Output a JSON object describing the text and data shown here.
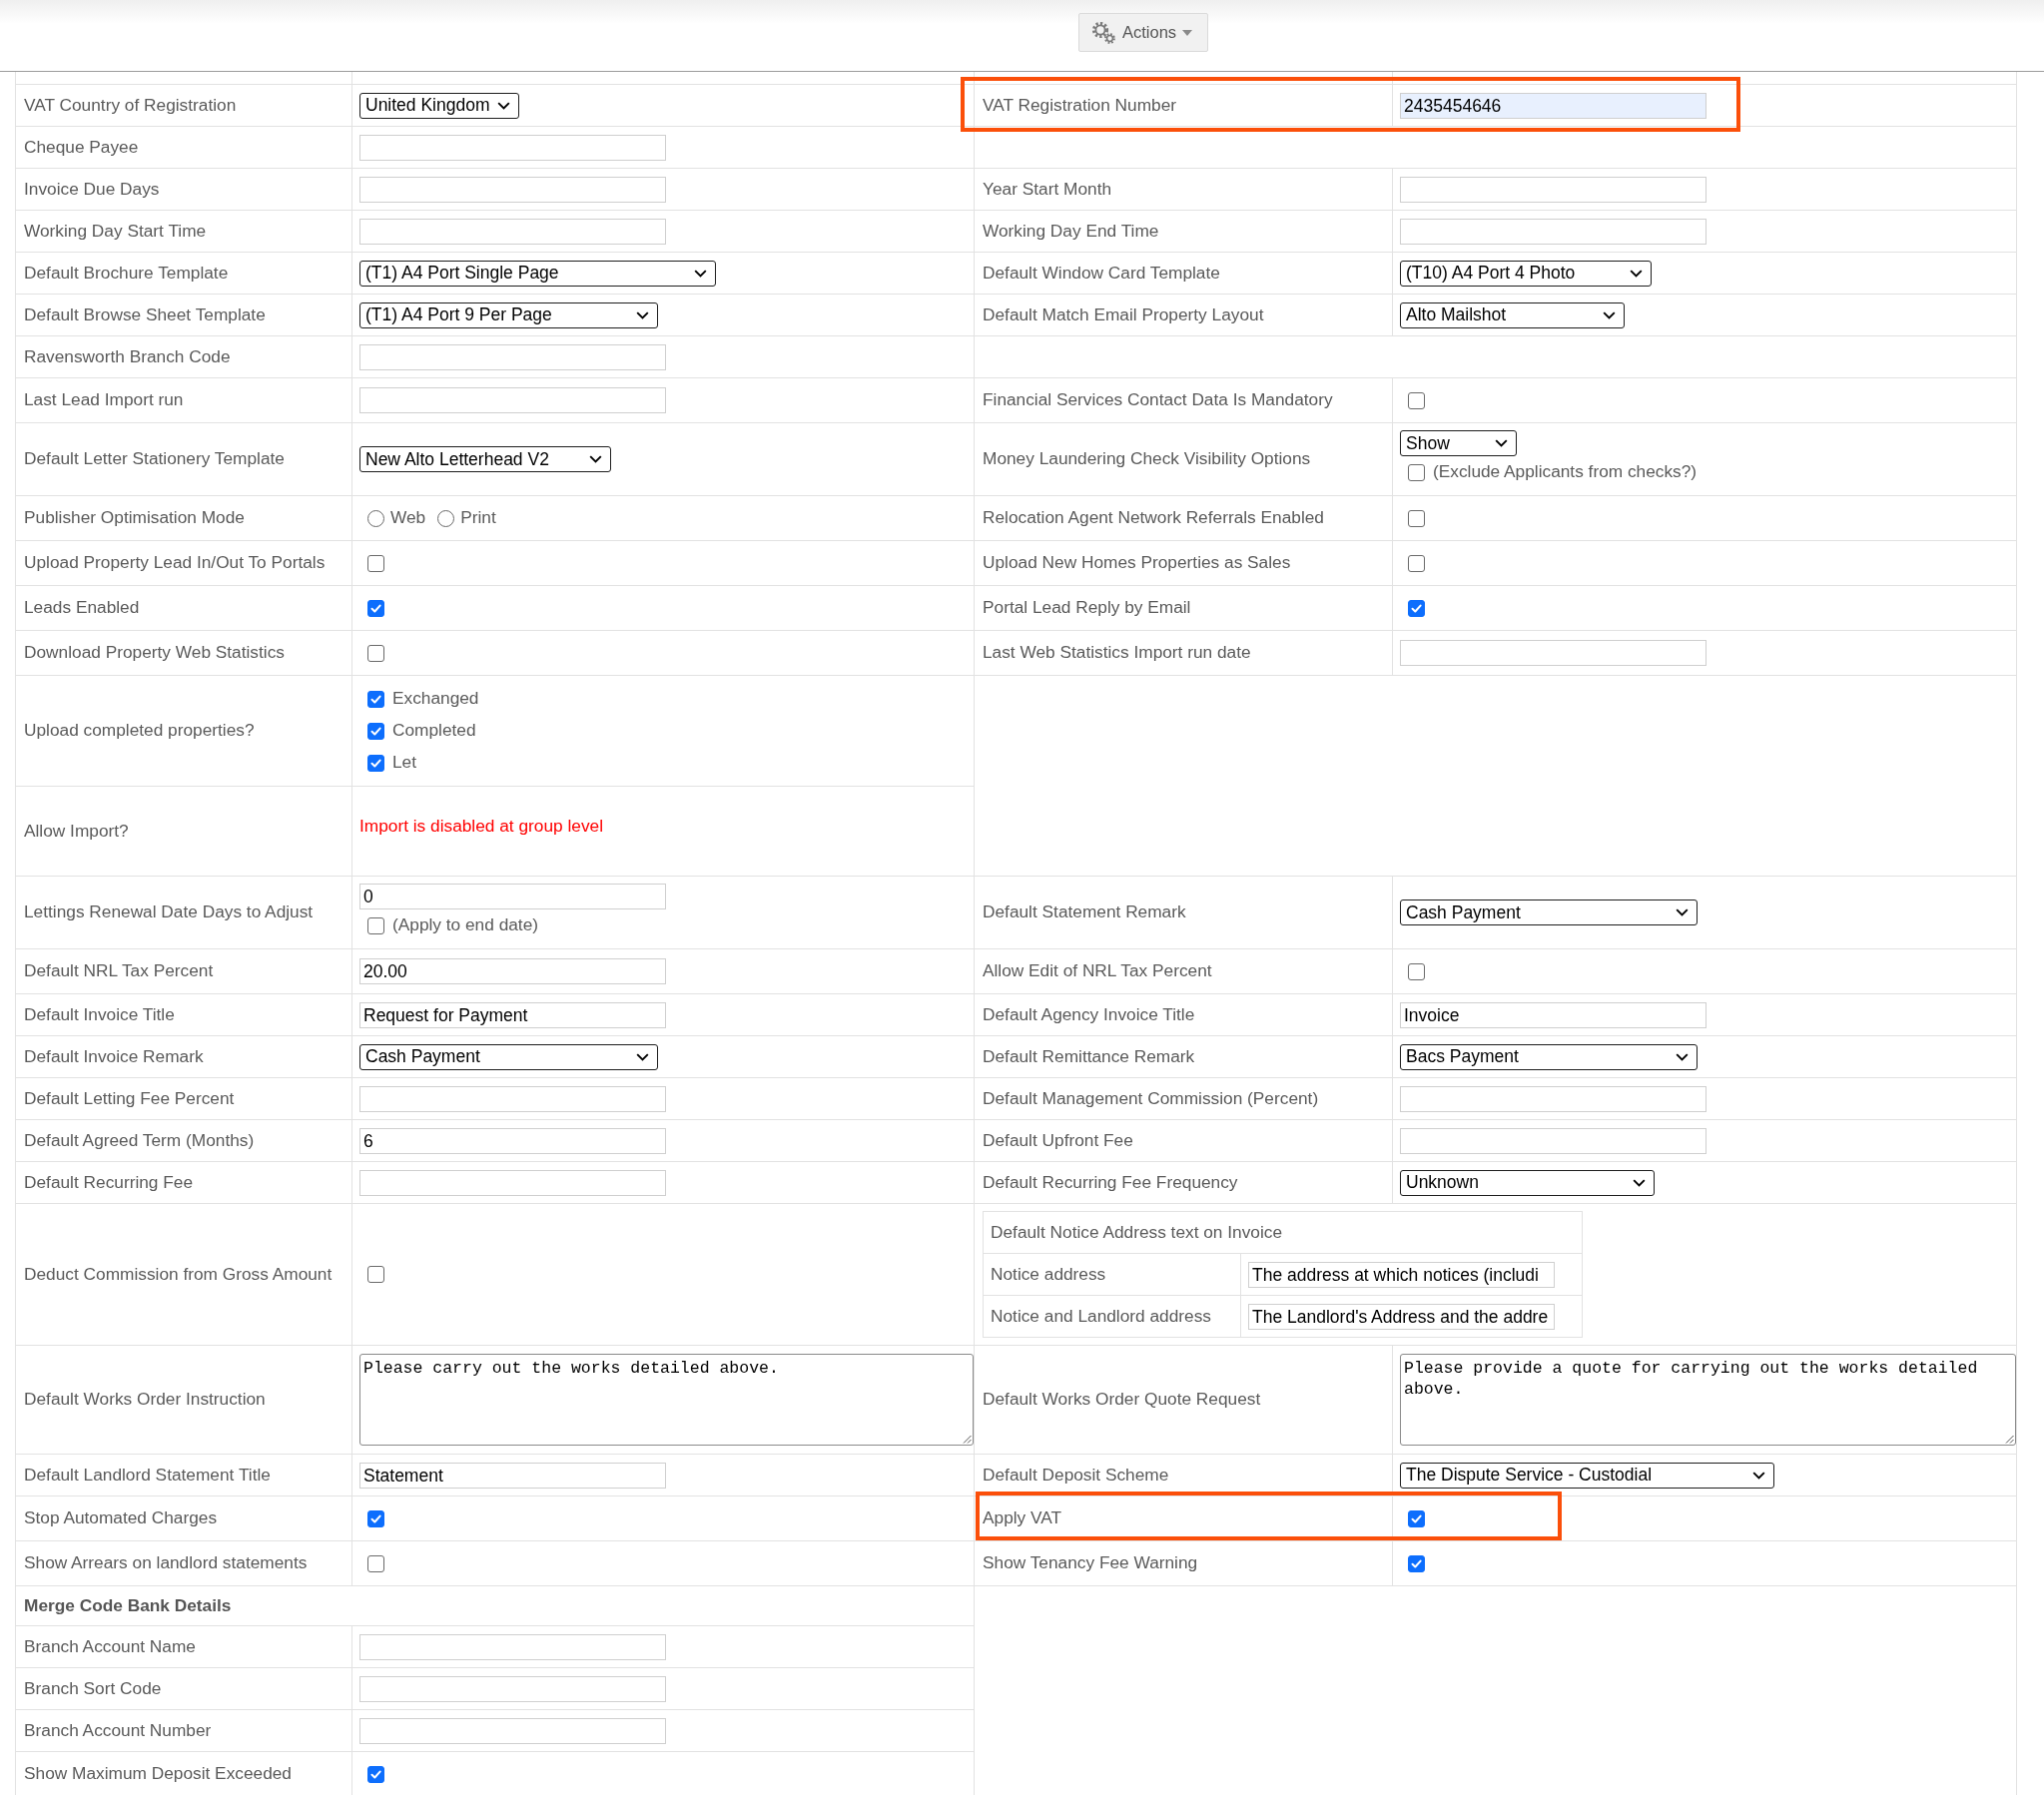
{
  "header": {
    "actions_button": {
      "label": "Actions"
    }
  },
  "settings": {
    "rows": [
      {
        "left": {
          "label": "VAT Country of Registration",
          "controls": [
            {
              "kind": "select",
              "value": "United Kingdom"
            }
          ]
        },
        "right": {
          "label": "VAT Registration Number",
          "highlighted": true,
          "controls": [
            {
              "kind": "text",
              "value": "2435454646",
              "autofilled": true
            }
          ]
        }
      },
      {
        "left": {
          "label": "Cheque Payee",
          "controls": [
            {
              "kind": "text"
            }
          ]
        }
      },
      {
        "left": {
          "label": "Invoice Due Days",
          "controls": [
            {
              "kind": "text"
            }
          ]
        },
        "right": {
          "label": "Year Start Month",
          "controls": [
            {
              "kind": "text"
            }
          ]
        }
      },
      {
        "left": {
          "label": "Working Day Start Time",
          "controls": [
            {
              "kind": "text"
            }
          ]
        },
        "right": {
          "label": "Working Day End Time",
          "controls": [
            {
              "kind": "text"
            }
          ]
        }
      },
      {
        "left": {
          "label": "Default Brochure Template",
          "controls": [
            {
              "kind": "select",
              "value": "(T1) A4 Port Single Page"
            }
          ]
        },
        "right": {
          "label": "Default Window Card Template",
          "controls": [
            {
              "kind": "select",
              "value": "(T10) A4 Port 4 Photo"
            }
          ]
        }
      },
      {
        "left": {
          "label": "Default Browse Sheet Template",
          "controls": [
            {
              "kind": "select",
              "value": "(T1) A4 Port 9 Per Page"
            }
          ]
        },
        "right": {
          "label": "Default Match Email Property Layout",
          "controls": [
            {
              "kind": "select",
              "value": "Alto Mailshot"
            }
          ]
        }
      },
      {
        "left": {
          "label": "Ravensworth Branch Code",
          "controls": [
            {
              "kind": "text"
            }
          ]
        }
      },
      {
        "left": {
          "label": "Last Lead Import run",
          "controls": [
            {
              "kind": "text"
            }
          ]
        },
        "right": {
          "label": "Financial Services Contact Data Is Mandatory",
          "controls": [
            {
              "kind": "checkbox",
              "checked": false
            }
          ]
        }
      },
      {
        "left": {
          "label": "Default Letter Stationery Template",
          "controls": [
            {
              "kind": "select",
              "value": "New Alto Letterhead V2"
            }
          ]
        },
        "right": {
          "label": "Money Laundering Check Visibility Options",
          "controls": [
            {
              "kind": "select",
              "value": "Show"
            },
            {
              "kind": "checkbox",
              "checked": false,
              "label": "(Exclude Applicants from checks?)"
            }
          ]
        }
      },
      {
        "left": {
          "label": "Publisher Optimisation Mode",
          "controls": [
            {
              "kind": "radio",
              "options": [
                {
                  "label": "Web",
                  "selected": false
                },
                {
                  "label": "Print",
                  "selected": false
                }
              ]
            }
          ]
        },
        "right": {
          "label": "Relocation Agent Network Referrals Enabled",
          "controls": [
            {
              "kind": "checkbox",
              "checked": false
            }
          ]
        }
      },
      {
        "left": {
          "label": "Upload Property Lead In/Out To Portals",
          "controls": [
            {
              "kind": "checkbox",
              "checked": false
            }
          ]
        },
        "right": {
          "label": "Upload New Homes Properties as Sales",
          "controls": [
            {
              "kind": "checkbox",
              "checked": false
            }
          ]
        }
      },
      {
        "left": {
          "label": "Leads Enabled",
          "controls": [
            {
              "kind": "checkbox",
              "checked": true
            }
          ]
        },
        "right": {
          "label": "Portal Lead Reply by Email",
          "controls": [
            {
              "kind": "checkbox",
              "checked": true
            }
          ]
        }
      },
      {
        "left": {
          "label": "Download Property Web Statistics",
          "controls": [
            {
              "kind": "checkbox",
              "checked": false
            }
          ]
        },
        "right": {
          "label": "Last Web Statistics Import run date",
          "controls": [
            {
              "kind": "text"
            }
          ]
        }
      },
      {
        "left": {
          "label": "Upload completed properties?",
          "controls": [
            {
              "kind": "checkbox",
              "checked": true,
              "label": "Exchanged"
            },
            {
              "kind": "checkbox",
              "checked": true,
              "label": "Completed"
            },
            {
              "kind": "checkbox",
              "checked": true,
              "label": "Let"
            }
          ]
        }
      },
      {
        "left": {
          "label": "Allow Import?",
          "controls": [
            {
              "kind": "message",
              "text": "Import is disabled at group level"
            }
          ]
        }
      },
      {
        "left": {
          "label": "Lettings Renewal Date Days to Adjust",
          "controls": [
            {
              "kind": "text",
              "value": "0"
            },
            {
              "kind": "checkbox",
              "checked": false,
              "label": "(Apply to end date)"
            }
          ]
        },
        "right": {
          "label": "Default Statement Remark",
          "controls": [
            {
              "kind": "select",
              "value": "Cash Payment"
            }
          ]
        }
      },
      {
        "left": {
          "label": "Default NRL Tax Percent",
          "controls": [
            {
              "kind": "text",
              "value": "20.00"
            }
          ]
        },
        "right": {
          "label": "Allow Edit of NRL Tax Percent",
          "controls": [
            {
              "kind": "checkbox",
              "checked": false
            }
          ]
        }
      },
      {
        "left": {
          "label": "Default Invoice Title",
          "controls": [
            {
              "kind": "text",
              "value": "Request for Payment"
            }
          ]
        },
        "right": {
          "label": "Default Agency Invoice Title",
          "controls": [
            {
              "kind": "text",
              "value": "Invoice"
            }
          ]
        }
      },
      {
        "left": {
          "label": "Default Invoice Remark",
          "controls": [
            {
              "kind": "select",
              "value": "Cash Payment"
            }
          ]
        },
        "right": {
          "label": "Default Remittance Remark",
          "controls": [
            {
              "kind": "select",
              "value": "Bacs Payment"
            }
          ]
        }
      },
      {
        "left": {
          "label": "Default Letting Fee Percent",
          "controls": [
            {
              "kind": "text"
            }
          ]
        },
        "right": {
          "label": "Default Management Commission (Percent)",
          "controls": [
            {
              "kind": "text"
            }
          ]
        }
      },
      {
        "left": {
          "label": "Default Agreed Term (Months)",
          "controls": [
            {
              "kind": "text",
              "value": "6"
            }
          ]
        },
        "right": {
          "label": "Default Upfront Fee",
          "controls": [
            {
              "kind": "text"
            }
          ]
        }
      },
      {
        "left": {
          "label": "Default Recurring Fee",
          "controls": [
            {
              "kind": "text"
            }
          ]
        },
        "right": {
          "label": "Default Recurring Fee Frequency",
          "controls": [
            {
              "kind": "select",
              "value": "Unknown"
            }
          ]
        }
      },
      {
        "left": {
          "label": "Deduct Commission from Gross Amount",
          "controls": [
            {
              "kind": "checkbox",
              "checked": false
            }
          ]
        },
        "right": {
          "notice_table": {
            "title": "Default Notice Address text on Invoice",
            "rows": [
              {
                "label": "Notice address",
                "value": "The address at which notices (includi"
              },
              {
                "label": "Notice and Landlord address",
                "value": "The Landlord's Address and the addre"
              }
            ]
          }
        }
      },
      {
        "left": {
          "label": "Default Works Order Instruction",
          "controls": [
            {
              "kind": "textarea",
              "value": "Please carry out the works detailed above."
            }
          ]
        },
        "right": {
          "label": "Default Works Order Quote Request",
          "controls": [
            {
              "kind": "textarea",
              "value": "Please provide a quote for carrying out the works detailed above."
            }
          ]
        }
      },
      {
        "left": {
          "label": "Default Landlord Statement Title",
          "controls": [
            {
              "kind": "text",
              "value": "Statement"
            }
          ]
        },
        "right": {
          "label": "Default Deposit Scheme",
          "controls": [
            {
              "kind": "select",
              "value": "The Dispute Service - Custodial"
            }
          ]
        }
      },
      {
        "left": {
          "label": "Stop Automated Charges",
          "controls": [
            {
              "kind": "checkbox",
              "checked": true
            }
          ]
        },
        "right": {
          "label": "Apply VAT",
          "highlighted": true,
          "controls": [
            {
              "kind": "checkbox",
              "checked": true
            }
          ]
        }
      },
      {
        "left": {
          "label": "Show Arrears on landlord statements",
          "controls": [
            {
              "kind": "checkbox",
              "checked": false
            }
          ]
        },
        "right": {
          "label": "Show Tenancy Fee Warning",
          "controls": [
            {
              "kind": "checkbox",
              "checked": true
            }
          ]
        }
      },
      {
        "left": {
          "heading": "Merge Code Bank Details"
        }
      },
      {
        "left": {
          "label": "Branch Account Name",
          "controls": [
            {
              "kind": "text"
            }
          ]
        }
      },
      {
        "left": {
          "label": "Branch Sort Code",
          "controls": [
            {
              "kind": "text"
            }
          ]
        }
      },
      {
        "left": {
          "label": "Branch Account Number",
          "controls": [
            {
              "kind": "text"
            }
          ]
        }
      },
      {
        "left": {
          "label": "Show Maximum Deposit Exceeded",
          "controls": [
            {
              "kind": "checkbox",
              "checked": true
            }
          ]
        }
      }
    ]
  }
}
